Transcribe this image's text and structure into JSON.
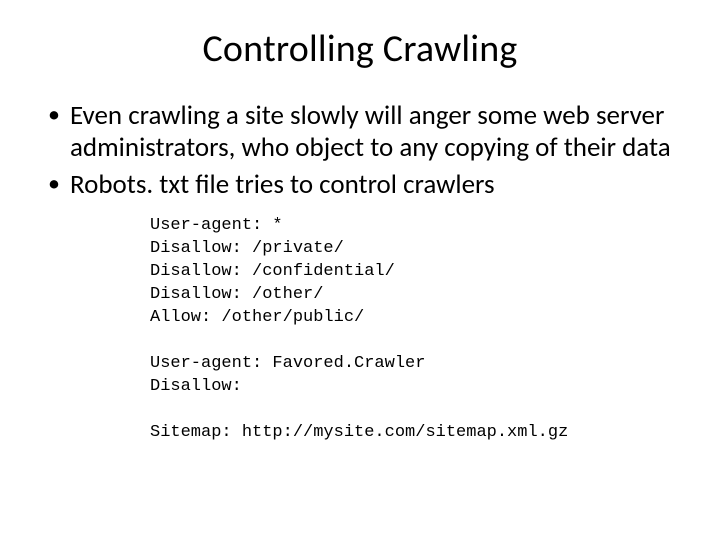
{
  "title": "Controlling Crawling",
  "bullets": [
    "Even crawling a site slowly will anger some web server administrators, who object to any copying of their data",
    "Robots. txt file tries to control crawlers"
  ],
  "robots_txt": "User-agent: *\nDisallow: /private/\nDisallow: /confidential/\nDisallow: /other/\nAllow: /other/public/\n\nUser-agent: Favored.Crawler\nDisallow:\n\nSitemap: http://mysite.com/sitemap.xml.gz"
}
